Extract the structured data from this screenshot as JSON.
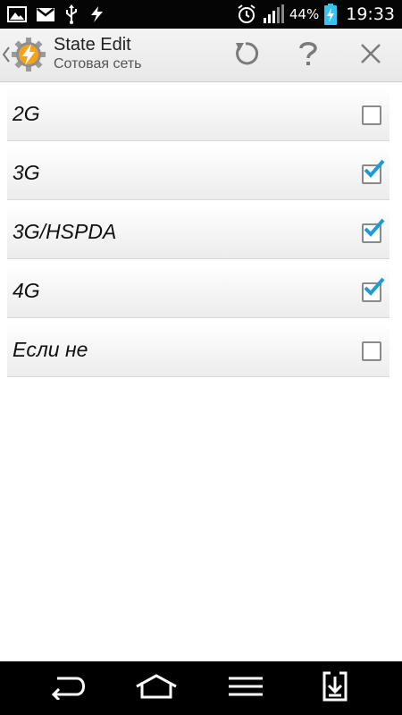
{
  "status_bar": {
    "battery_percent": "44%",
    "time": "19:33",
    "icons": [
      "gallery-icon",
      "gmail-icon",
      "usb-icon",
      "tasker-bolt-icon",
      "alarm-icon",
      "signal-icon",
      "battery-charging-icon"
    ]
  },
  "action_bar": {
    "title": "State Edit",
    "subtitle": "Сотовая сеть",
    "icons": [
      "up-caret-icon",
      "tasker-app-icon",
      "revert-icon",
      "help-icon",
      "close-icon"
    ]
  },
  "options": [
    {
      "label": "2G",
      "checked": false
    },
    {
      "label": "3G",
      "checked": true
    },
    {
      "label": "3G/HSPDA",
      "checked": true
    },
    {
      "label": "4G",
      "checked": true
    },
    {
      "label": "Если не",
      "checked": false
    }
  ],
  "colors": {
    "status_bar_bg": "#050505",
    "action_bar_bg": "#ececec",
    "check_accent": "#1e9bd7",
    "battery_charging": "#36c3ef",
    "app_icon_orange": "#f3a21b"
  },
  "nav_bar": {
    "icons": [
      "back-icon",
      "home-icon",
      "menu-icon",
      "notifications-icon"
    ]
  }
}
